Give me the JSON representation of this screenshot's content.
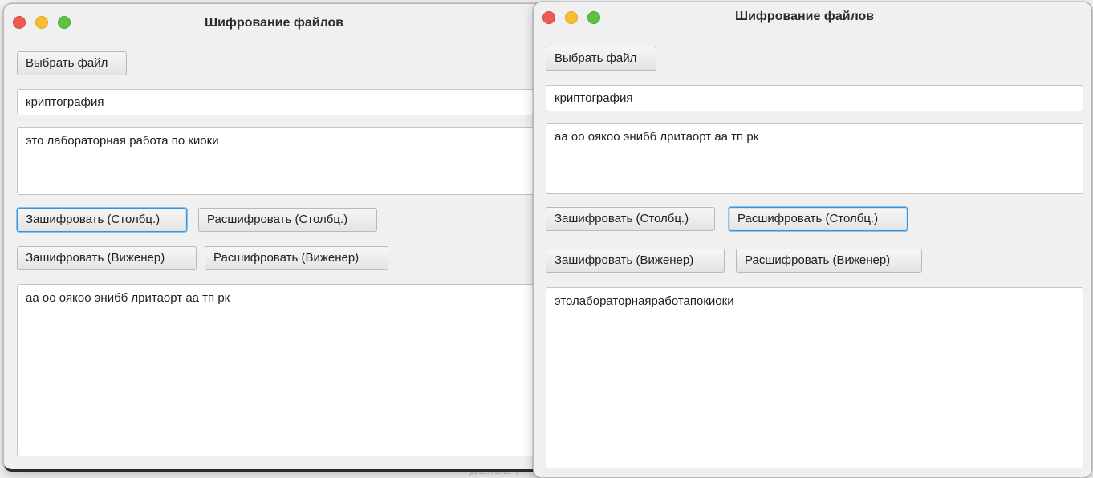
{
  "left_window": {
    "title": "Шифрование файлов",
    "choose_file_label": "Выбрать файл",
    "key_value": "криптография",
    "input_text": "это лабораторная работа по киоки",
    "encrypt_columnar_label": "Зашифровать (Столбц.)",
    "decrypt_columnar_label": "Расшифровать (Столбц.)",
    "encrypt_vigenere_label": "Зашифровать (Виженер)",
    "decrypt_vigenere_label": "Расшифровать (Виженер)",
    "output_text": "аа оо оякоо энибб лритаорт аа тп рк"
  },
  "right_window": {
    "title": "Шифрование файлов",
    "choose_file_label": "Выбрать файл",
    "key_value": "криптография",
    "input_text": "аа оо оякоо энибб лритаорт аа тп рк",
    "encrypt_columnar_label": "Зашифровать (Столбц.)",
    "decrypt_columnar_label": "Расшифровать (Столбц.)",
    "encrypt_vigenere_label": "Зашифровать (Виженер)",
    "decrypt_vigenere_label": "Расшифровать (Виженер)",
    "output_text": "этолабораторнаяработапокиоки"
  },
  "background_text": "ГДЕ..ВЕЧ",
  "colors": {
    "window_bg": "#f0f0f0",
    "close_button": "#ee5b52",
    "minimize_button": "#f6be2f",
    "maximize_button": "#5ac43f",
    "focus_ring": "#3a95d8"
  }
}
